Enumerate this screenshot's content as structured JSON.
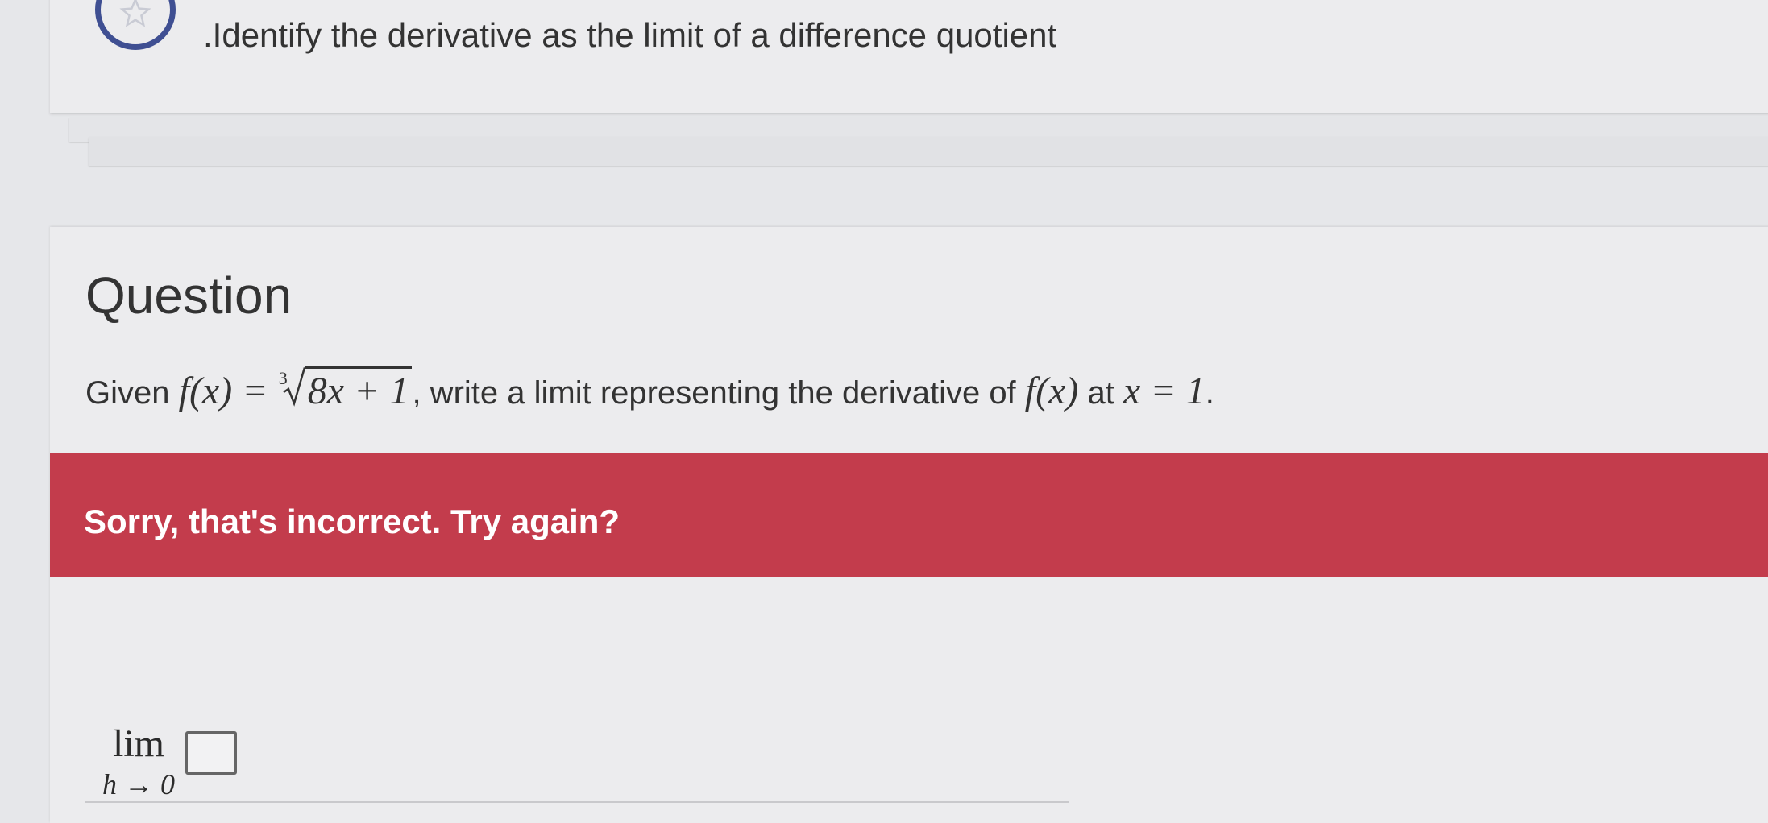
{
  "objective": {
    "bullet": ".",
    "title": "Identify the derivative as the limit of a difference quotient",
    "icon": "star-icon",
    "ring_color": "#3f4f92"
  },
  "question": {
    "heading": "Question",
    "prefix": "Given",
    "function_lhs": "f(x) =",
    "root_index": "3",
    "radicand": "8x + 1",
    "middle": ", write a limit representing the derivative of",
    "function_ref": "f(x)",
    "at_word": "at",
    "point": "x = 1",
    "end": "."
  },
  "feedback": {
    "message": "Sorry, that's incorrect. Try again?",
    "color": "#c33c4c"
  },
  "answer": {
    "lim_label": "lim",
    "lim_sub": "h → 0",
    "value": ""
  }
}
